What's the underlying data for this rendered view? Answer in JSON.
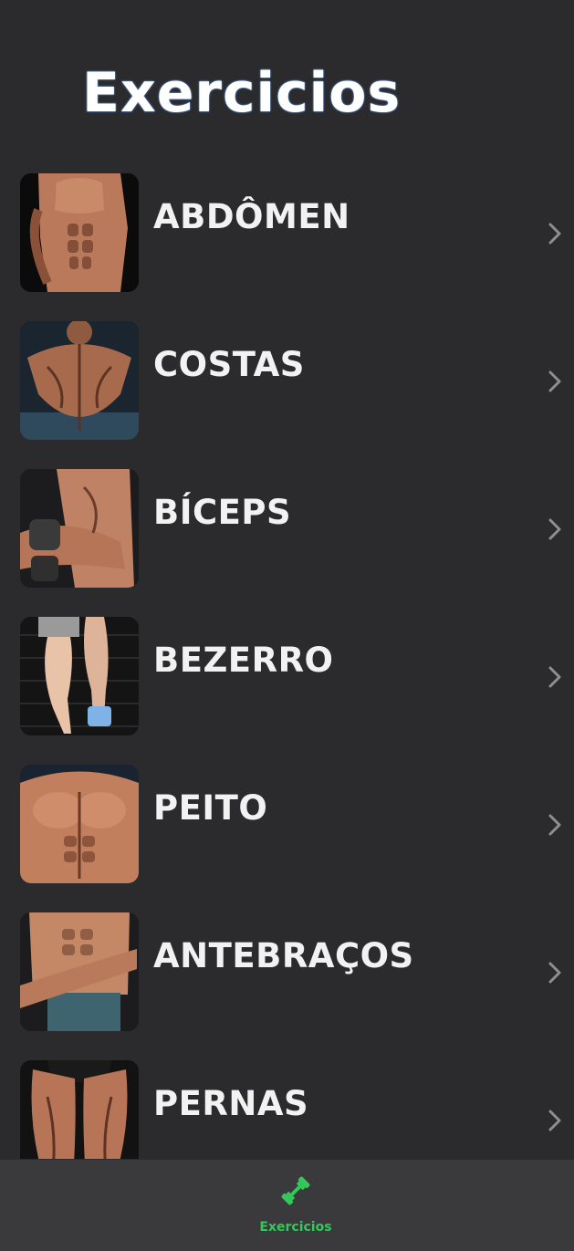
{
  "header": {
    "title": "Exercicios"
  },
  "exercise_list": [
    {
      "label": "ABDÔMEN",
      "image": "abs-photo",
      "skin": "#b9795a",
      "shade": "#6e3e2a"
    },
    {
      "label": "COSTAS",
      "image": "back-photo",
      "skin": "#a86a4c",
      "shade": "#5a3322"
    },
    {
      "label": "BÍCEPS",
      "image": "biceps-photo",
      "skin": "#c08264",
      "shade": "#6a3d2b"
    },
    {
      "label": "BEZERRO",
      "image": "calves-photo",
      "skin": "#e8c3a8",
      "shade": "#8a6a58"
    },
    {
      "label": "PEITO",
      "image": "chest-photo",
      "skin": "#c27f5e",
      "shade": "#6b3a26"
    },
    {
      "label": "ANTEBRAÇOS",
      "image": "forearms-photo",
      "skin": "#c48866",
      "shade": "#6e432e"
    },
    {
      "label": "PERNAS",
      "image": "legs-photo",
      "skin": "#b87456",
      "shade": "#5e3324"
    }
  ],
  "tab_bar": {
    "tabs": [
      {
        "label": "Exercicios",
        "icon": "dumbbell-icon",
        "active": true
      }
    ]
  },
  "colors": {
    "background": "#2b2b2d",
    "tab_bar": "#3a3a3c",
    "accent": "#34c759",
    "text": "#ffffff",
    "chevron": "#8e8e93"
  }
}
